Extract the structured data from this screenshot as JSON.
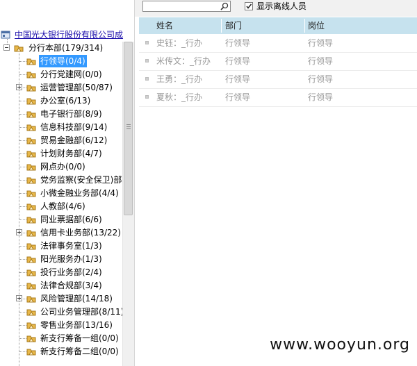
{
  "tree": {
    "root_label": "中国光大银行股份有限公司成",
    "branch_label": "分行本部(179/314)",
    "items": [
      {
        "label": "行领导(0/4)",
        "selected": true,
        "expandable": false
      },
      {
        "label": "分行党建网(0/0)",
        "selected": false,
        "expandable": false
      },
      {
        "label": "运营管理部(50/87)",
        "selected": false,
        "expandable": true
      },
      {
        "label": "办公室(6/13)",
        "selected": false,
        "expandable": false
      },
      {
        "label": "电子银行部(8/9)",
        "selected": false,
        "expandable": false
      },
      {
        "label": "信息科技部(9/14)",
        "selected": false,
        "expandable": false
      },
      {
        "label": "贸易金融部(6/12)",
        "selected": false,
        "expandable": false
      },
      {
        "label": "计划财务部(4/7)",
        "selected": false,
        "expandable": false
      },
      {
        "label": "网点办(0/0)",
        "selected": false,
        "expandable": false
      },
      {
        "label": "党务监察(安全保卫)部",
        "selected": false,
        "expandable": false
      },
      {
        "label": "小微金融业务部(4/4)",
        "selected": false,
        "expandable": false
      },
      {
        "label": "人教部(4/6)",
        "selected": false,
        "expandable": false
      },
      {
        "label": "同业票据部(6/6)",
        "selected": false,
        "expandable": false
      },
      {
        "label": "信用卡业务部(13/22)",
        "selected": false,
        "expandable": true
      },
      {
        "label": "法律事务室(1/3)",
        "selected": false,
        "expandable": false
      },
      {
        "label": "阳光服务办(1/3)",
        "selected": false,
        "expandable": false
      },
      {
        "label": "投行业务部(2/4)",
        "selected": false,
        "expandable": false
      },
      {
        "label": "法律合规部(3/4)",
        "selected": false,
        "expandable": false
      },
      {
        "label": "风险管理部(14/18)",
        "selected": false,
        "expandable": true
      },
      {
        "label": "公司业务管理部(8/11)",
        "selected": false,
        "expandable": false
      },
      {
        "label": "零售业务部(13/16)",
        "selected": false,
        "expandable": false
      },
      {
        "label": "新支行筹备一组(0/0)",
        "selected": false,
        "expandable": false
      },
      {
        "label": "新支行筹备二组(0/0)",
        "selected": false,
        "expandable": false
      }
    ]
  },
  "toolbar": {
    "search_value": "",
    "search_placeholder": "",
    "show_offline_label": "显示离线人员",
    "show_offline_checked": true
  },
  "grid": {
    "columns": [
      "姓名",
      "部门",
      "岗位"
    ],
    "rows": [
      {
        "name": "史钰：_行办",
        "dept": "行领导",
        "post": "行领导"
      },
      {
        "name": "米传文：_行办",
        "dept": "行领导",
        "post": "行领导"
      },
      {
        "name": "王勇：_行办",
        "dept": "行领导",
        "post": "行领导"
      },
      {
        "name": "夏秋：_行办",
        "dept": "行领导",
        "post": "行领导"
      }
    ]
  },
  "watermark": "www.wooyun.org",
  "colors": {
    "header_bg": "#c6e2ee",
    "selected_bg": "#3399ff",
    "row_text": "#999999",
    "folder": "#e8b84a"
  }
}
